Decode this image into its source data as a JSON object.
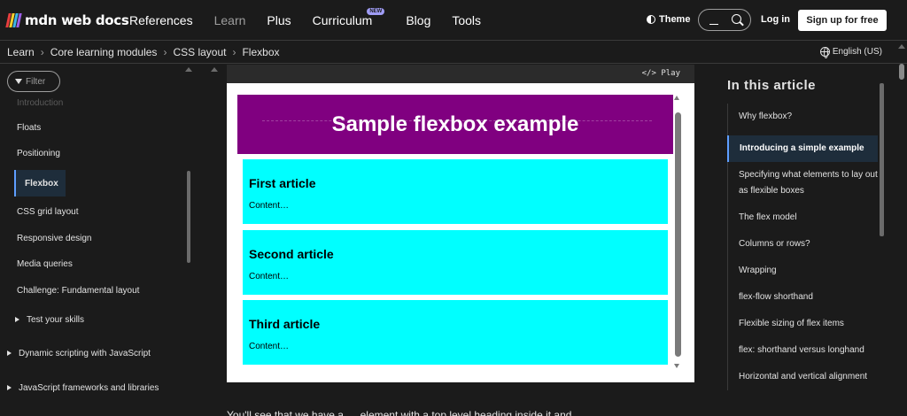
{
  "brand": {
    "logo_text": "mdn web docs"
  },
  "nav": {
    "links": [
      "References",
      "Learn",
      "Plus",
      "Curriculum",
      "Blog",
      "Tools"
    ],
    "new_badge": "NEW",
    "theme_label": "Theme",
    "login_label": "Log in",
    "signup_label": "Sign up for free"
  },
  "breadcrumb": [
    "Learn",
    "Core learning modules",
    "CSS layout",
    "Flexbox"
  ],
  "language": "English (US)",
  "sidebar": {
    "filter_placeholder": "Filter",
    "items": [
      "Introduction",
      "Floats",
      "Positioning",
      "Flexbox",
      "CSS grid layout",
      "Responsive design",
      "Media queries",
      "Challenge: Fundamental layout",
      "Test your skills",
      "Dynamic scripting with JavaScript",
      "JavaScript frameworks and libraries"
    ]
  },
  "playground": {
    "play_label": "</> Play"
  },
  "demo": {
    "title": "Sample flexbox example",
    "articles": [
      {
        "heading": "First article",
        "body": "Content…"
      },
      {
        "heading": "Second article",
        "body": "Content…"
      },
      {
        "heading": "Third article",
        "body": "Content…"
      }
    ]
  },
  "main": {
    "partial_text": "You'll see that we have a … element with a top level heading inside it and …"
  },
  "toc": {
    "title": "In this article",
    "items": [
      "Why flexbox?",
      "Introducing a simple example",
      "Specifying what elements to lay out as flexible boxes",
      "The flex model",
      "Columns or rows?",
      "Wrapping",
      "flex-flow shorthand",
      "Flexible sizing of flex items",
      "flex: shorthand versus longhand",
      "Horizontal and vertical alignment"
    ],
    "active_index": 1
  },
  "colors": {
    "accent": "#5e9eff",
    "header_bg": "#800080",
    "article_bg": "#00ffff",
    "badge": "#9f9cf5"
  }
}
